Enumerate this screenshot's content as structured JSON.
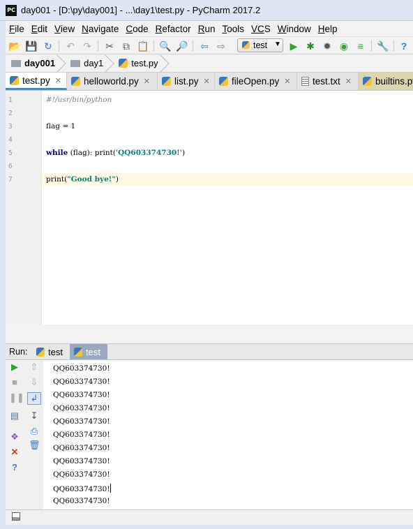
{
  "window": {
    "title": "day001 - [D:\\py\\day001] - ...\\day1\\test.py - PyCharm 2017.2",
    "logo": "PC"
  },
  "menu": [
    {
      "first": "F",
      "rest": "ile"
    },
    {
      "first": "E",
      "rest": "dit"
    },
    {
      "first": "V",
      "rest": "iew"
    },
    {
      "first": "N",
      "rest": "avigate"
    },
    {
      "first": "C",
      "rest": "ode"
    },
    {
      "first": "R",
      "rest": "efactor"
    },
    {
      "first": "R",
      "rest": "un"
    },
    {
      "first": "T",
      "rest": "ools"
    },
    {
      "first": "VC",
      "rest": "S"
    },
    {
      "first": "W",
      "rest": "indow"
    },
    {
      "first": "H",
      "rest": "elp"
    }
  ],
  "toolbar": {
    "run_config": "test"
  },
  "breadcrumb": {
    "project": "day001",
    "folder": "day1",
    "file": "test.py"
  },
  "tabs": [
    {
      "label": "test.py",
      "icon": "python-file-icon"
    },
    {
      "label": "helloworld.py",
      "icon": "python-file-icon"
    },
    {
      "label": "list.py",
      "icon": "python-file-icon"
    },
    {
      "label": "fileOpen.py",
      "icon": "python-file-icon"
    },
    {
      "label": "test.txt",
      "icon": "text-file-icon"
    },
    {
      "label": "builtins.py",
      "icon": "python-file-icon"
    }
  ],
  "editor": {
    "line_numbers": [
      "1",
      "2",
      "3",
      "4",
      "5",
      "6",
      "7"
    ],
    "line1": "#!/usr/bin/python",
    "line3": "flag = 1",
    "line5": {
      "kw": "while",
      "mid": " (flag): print(",
      "str": "'QQ603374730!'",
      "end": ")"
    },
    "line7": {
      "start": "print(",
      "str": "\"Good bye!\"",
      "end": ")"
    }
  },
  "run_panel": {
    "label": "Run:",
    "tabs": [
      "test",
      "test"
    ],
    "output": [
      "QQ603374730!",
      "QQ603374730!",
      "QQ603374730!",
      "QQ603374730!",
      "QQ603374730!",
      "QQ603374730!",
      "QQ603374730!",
      "QQ603374730!",
      "QQ603374730!",
      "QQ603374730!",
      "QQ603374730!"
    ]
  },
  "colors": {
    "keyword": "#000080",
    "string": "#008080",
    "comment": "#808080",
    "accent": "#4a88c7"
  }
}
